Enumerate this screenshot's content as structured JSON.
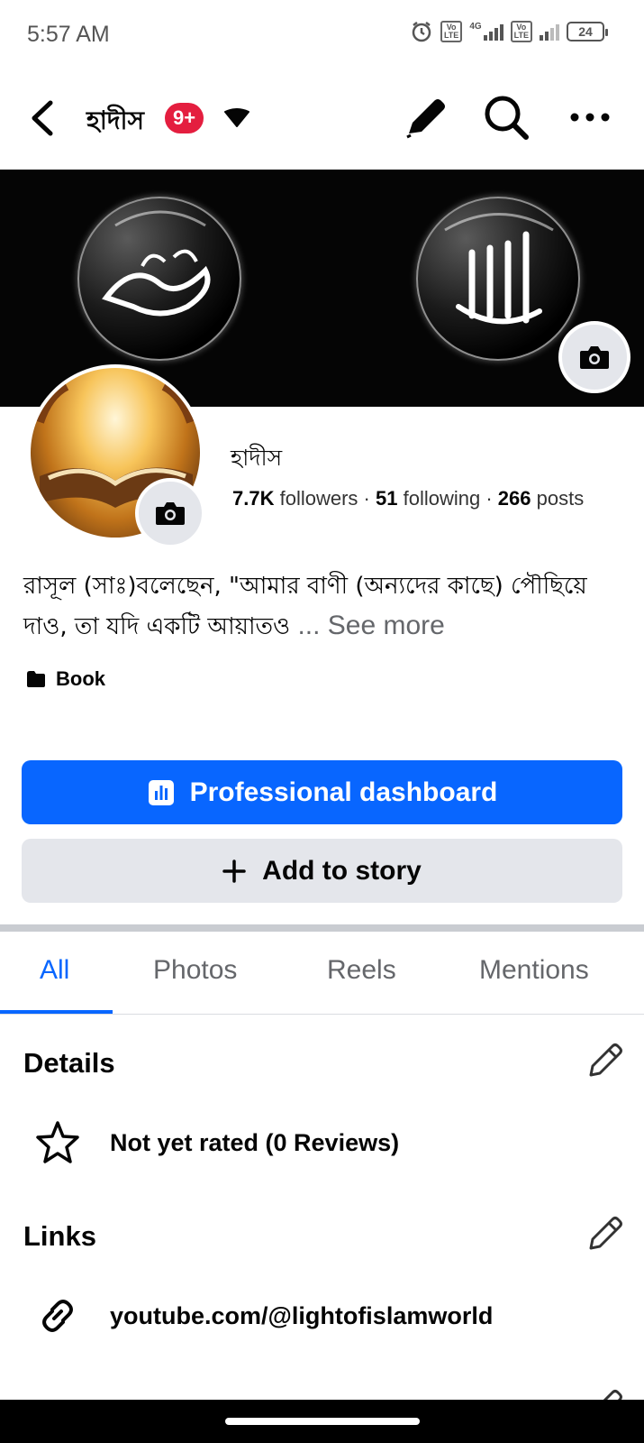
{
  "status_bar": {
    "time": "5:57 AM",
    "net1": "Vo\nLTE",
    "net_gen": "4G",
    "net2": "Vo\nLTE",
    "battery": "24"
  },
  "top_nav": {
    "title": "হাদীস",
    "badge": "9+"
  },
  "profile": {
    "name": "হাদীস",
    "followers_count": "7.7K",
    "followers_label": "followers",
    "following_count": "51",
    "following_label": "following",
    "posts_count": "266",
    "posts_label": "posts",
    "separator": " · "
  },
  "bio": {
    "text": "রাসূল (সাঃ)বলেছেন, \"আমার বাণী (অন্যদের কাছে) পৌছিয়ে দাও, তা যদি একটি আয়াতও",
    "see_more": "... See more"
  },
  "category": "Book",
  "buttons": {
    "professional_dashboard": "Professional dashboard",
    "add_to_story": "Add to story"
  },
  "tabs": [
    {
      "label": "All",
      "active": true
    },
    {
      "label": "Photos",
      "active": false
    },
    {
      "label": "Reels",
      "active": false
    },
    {
      "label": "Mentions",
      "active": false
    }
  ],
  "details": {
    "title": "Details",
    "rating": "Not yet rated (0 Reviews)"
  },
  "links": {
    "title": "Links",
    "url": "youtube.com/@lightofislamworld"
  },
  "colors": {
    "accent": "#0866ff",
    "badge": "#e41e3f",
    "secondary_button": "#e4e6eb",
    "muted_text": "#65676b"
  }
}
